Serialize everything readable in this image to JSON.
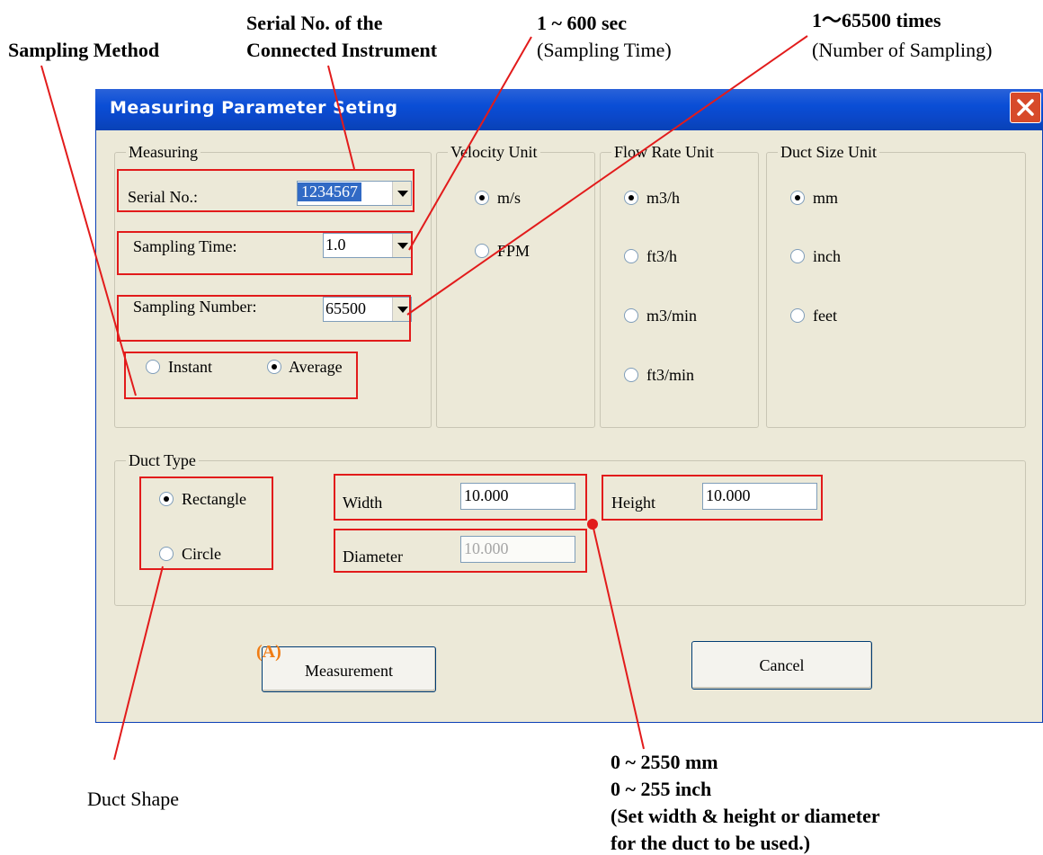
{
  "annotations": {
    "sampling_method": "Sampling Method",
    "serial_line1": "Serial No. of the",
    "serial_line2": "Connected Instrument",
    "time_range": "1 ~ 600 sec",
    "time_caption": "(Sampling Time)",
    "number_range": "1〜65500 times",
    "number_caption": "(Number of Sampling)",
    "duct_shape": "Duct Shape",
    "size_line1": "0 ~ 2550 mm",
    "size_line2": "0 ~ 255 inch",
    "size_line3": "(Set width & height or diameter",
    "size_line4": "for the duct to be used.)",
    "marker_a": "(A)"
  },
  "dialog": {
    "title": "Measuring Parameter Seting",
    "measuring": {
      "group_label": "Measuring",
      "serial_label": "Serial No.:",
      "serial_value": "1234567",
      "time_label": "Sampling Time:",
      "time_value": "1.0",
      "number_label": "Sampling Number:",
      "number_value": "65500",
      "method_options": [
        "Instant",
        "Average"
      ],
      "method_selected": "Average"
    },
    "velocity": {
      "group_label": "Velocity Unit",
      "options": [
        "m/s",
        "FPM"
      ],
      "selected": "m/s"
    },
    "flow": {
      "group_label": "Flow Rate Unit",
      "options": [
        "m3/h",
        "ft3/h",
        "m3/min",
        "ft3/min"
      ],
      "selected": "m3/h"
    },
    "duct_size": {
      "group_label": "Duct Size Unit",
      "options": [
        "mm",
        "inch",
        "feet"
      ],
      "selected": "mm"
    },
    "duct_type": {
      "group_label": "Duct Type",
      "shape_options": [
        "Rectangle",
        "Circle"
      ],
      "shape_selected": "Rectangle",
      "width_label": "Width",
      "width_value": "10.000",
      "height_label": "Height",
      "height_value": "10.000",
      "diameter_label": "Diameter",
      "diameter_value": "10.000"
    },
    "buttons": {
      "measurement": "Measurement",
      "cancel": "Cancel"
    }
  },
  "colors": {
    "titlebar": "#0a4ed6",
    "face": "#ece9d8",
    "annotation_red": "#e21b1b",
    "marker_orange": "#f07c14"
  }
}
